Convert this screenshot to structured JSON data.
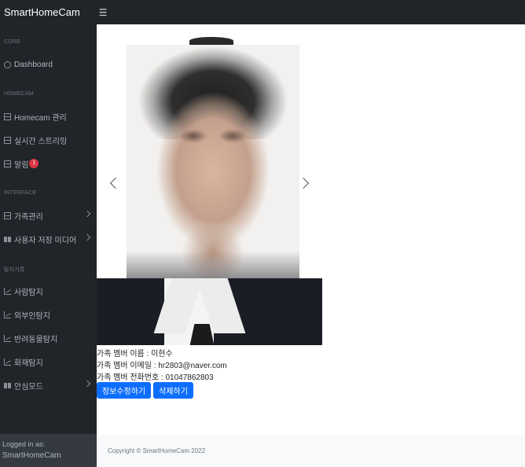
{
  "navbar": {
    "brand": "SmartHomeCam",
    "toggle_icon": "☰"
  },
  "sidebar": {
    "sections": [
      {
        "heading": "CORE"
      },
      {
        "heading": "HOMECAM"
      },
      {
        "heading": "INTERFACE"
      },
      {
        "heading": "탐지기록"
      }
    ],
    "items": [
      {
        "label": "Dashboard",
        "icon": "gauge-icon"
      },
      {
        "label": "Homecam 관리",
        "icon": "table-icon"
      },
      {
        "label": "실시간 스트리밍",
        "icon": "table-icon"
      },
      {
        "label": "알림",
        "icon": "table-icon",
        "badge": "1"
      },
      {
        "label": "가족관리",
        "icon": "table-icon",
        "has_chevron": true
      },
      {
        "label": "사용자 저장 미디어",
        "icon": "book-icon",
        "has_chevron": true
      },
      {
        "label": "사람탐지",
        "icon": "chart-icon"
      },
      {
        "label": "외부인탐지",
        "icon": "chart-icon"
      },
      {
        "label": "반려동물탐지",
        "icon": "chart-icon"
      },
      {
        "label": "화재탐지",
        "icon": "chart-icon"
      },
      {
        "label": "안심모드",
        "icon": "book-icon",
        "has_chevron": true
      }
    ],
    "footer": {
      "small": "Logged in as:",
      "user": "SmartHomeCam"
    }
  },
  "member": {
    "name_line": "가족 멤버 이름 : 이현수",
    "email_line": "가족 멤버 이메일 : hr2803@naver.com",
    "phone_line": "가족 멤버 전화번호 : 01047862803"
  },
  "buttons": {
    "edit": "정보수정하기",
    "delete": "삭제하기"
  },
  "footer": {
    "copyright": "Copyright © SmartHomeCam 2022"
  },
  "colors": {
    "sidebar_bg": "#212529",
    "primary": "#0d6efd",
    "badge": "#dc3545"
  }
}
